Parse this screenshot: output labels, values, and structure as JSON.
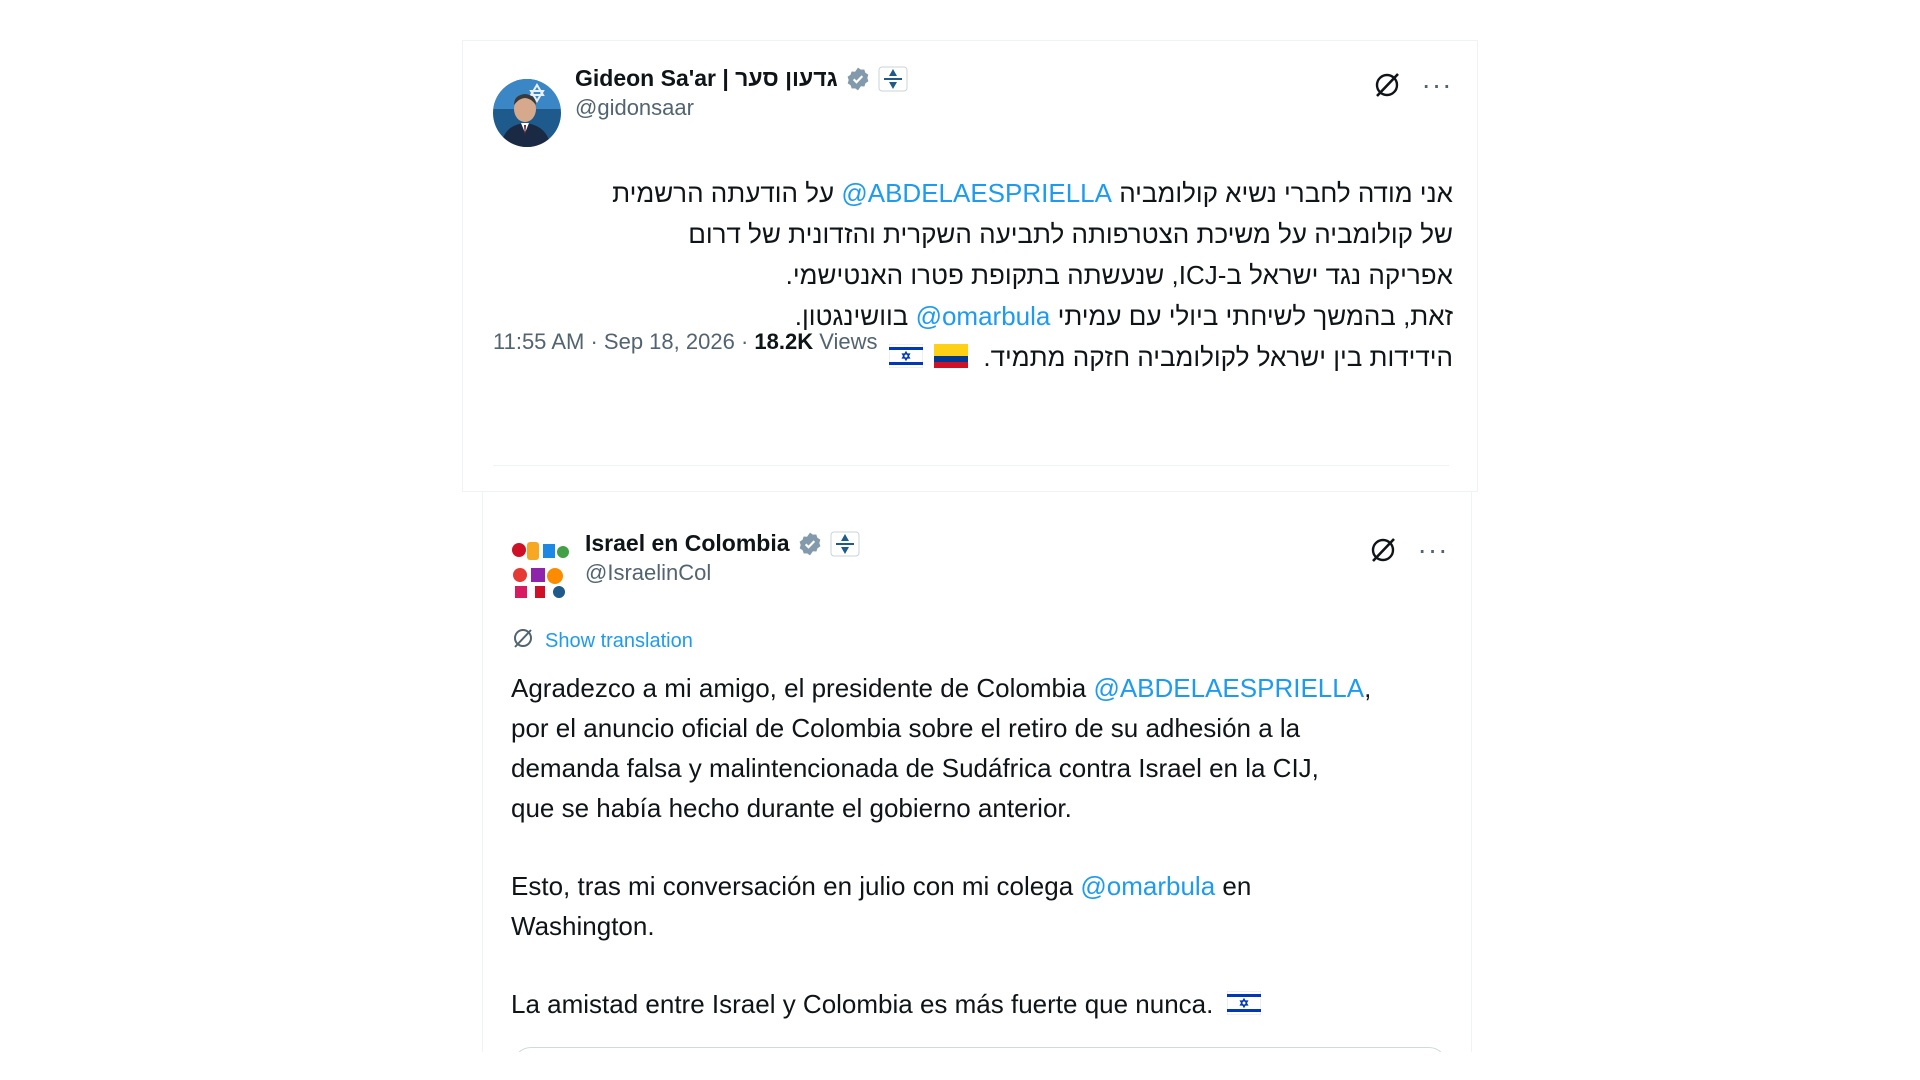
{
  "tweet_main": {
    "author_name": "Gideon Sa'ar | גדעון סער",
    "handle": "@gidonsaar",
    "lines": [
      {
        "before": "אני מודה לחברי נשיא  קולומביה ",
        "mention": "@ABDELAESPRIELLA",
        "after": " על הודעתה הרשמית"
      },
      {
        "text": "של קולומביה על משיכת הצטרפותה לתביעה השקרית והזדונית של דרום"
      },
      {
        "text": "אפריקה נגד ישראל ב-ICJ, שנעשתה בתקופת פטרו האנטישמי."
      },
      {
        "before": "זאת, בהמשך לשיחתי ביולי עם עמיתי ",
        "mention": "@omarbula",
        "after": " בוושינגטון."
      },
      {
        "text": "הידידות בין ישראל לקולומביה חזקה מתמיד."
      }
    ],
    "time": "11:55 AM",
    "date": "Sep 18, 2026",
    "views_count": "18.2K",
    "views_label": "Views"
  },
  "tweet_quoted": {
    "author_name": "Israel en Colombia",
    "handle": "@IsraelinCol",
    "show_translation": "Show translation",
    "paragraph1": [
      {
        "before": "Agradezco a mi amigo, el presidente de Colombia ",
        "mention": "@ABDELAESPRIELLA",
        "after": ","
      },
      {
        "text": "por el anuncio oficial de Colombia sobre el retiro de su adhesión a la"
      },
      {
        "text": "demanda falsa y malintencionada de Sudáfrica contra Israel en la CIJ,"
      },
      {
        "text": "que se había hecho durante el gobierno anterior."
      }
    ],
    "paragraph2": [
      {
        "before": "Esto, tras mi conversación en julio con mi colega ",
        "mention": "@omarbula",
        "after": " en"
      },
      {
        "text": "Washington."
      }
    ],
    "paragraph3": {
      "text": "La amistad entre Israel y Colombia es más fuerte que nunca."
    }
  },
  "icons": {
    "verified": "verified-badge-icon",
    "affiliation": "government-affiliation-icon",
    "grok": "grok-icon",
    "more": "more-options-icon",
    "translate": "translate-icon",
    "flag_israel": "israel-flag-icon",
    "flag_colombia": "colombia-flag-icon"
  },
  "colors": {
    "link": "#1d9bf0",
    "text": "#0f1419",
    "muted": "#536471",
    "verified": "#829aab"
  }
}
